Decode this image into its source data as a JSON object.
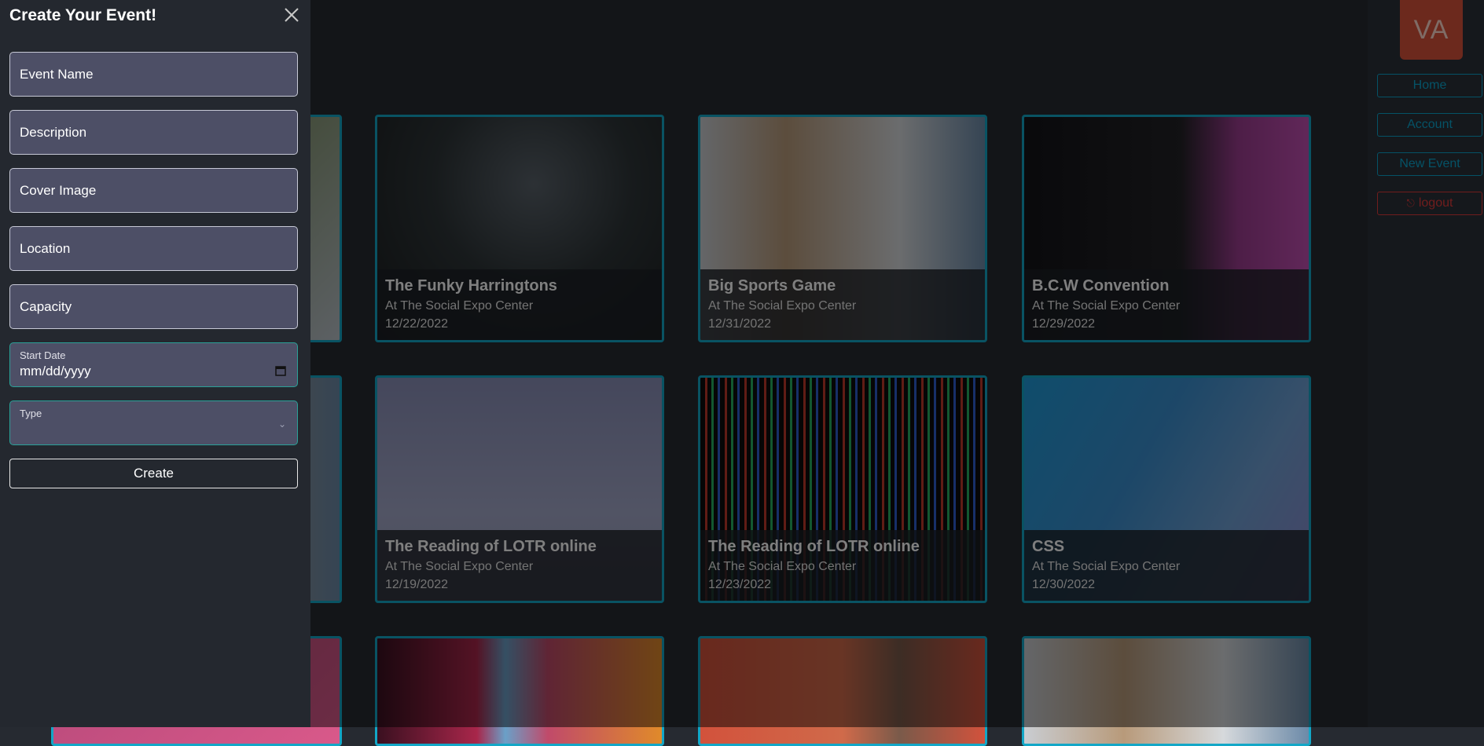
{
  "nav": {
    "avatar_initials": "VA",
    "home_label": "Home",
    "account_label": "Account",
    "new_event_label": "New Event",
    "logout_label": "logout",
    "accent_color": "#0aa4cc",
    "danger_color": "#e03a3a"
  },
  "events": [
    {
      "title": "The Funky Harringtons",
      "location": "At The Social Expo Center",
      "date": "12/22/2022"
    },
    {
      "title": "Big Sports Game",
      "location": "At The Social Expo Center",
      "date": "12/31/2022"
    },
    {
      "title": "B.C.W Convention",
      "location": "At The Social Expo Center",
      "date": "12/29/2022"
    },
    {
      "title": "The Reading of LOTR online",
      "location": "At The Social Expo Center",
      "date": "12/19/2022"
    },
    {
      "title": "The Reading of LOTR online",
      "location": "At The Social Expo Center",
      "date": "12/23/2022"
    },
    {
      "title": "CSS",
      "location": "At The Social Expo Center",
      "date": "12/30/2022"
    }
  ],
  "drawer": {
    "title": "Create Your Event!",
    "event_name_placeholder": "Event Name",
    "description_placeholder": "Description",
    "cover_image_placeholder": "Cover Image",
    "location_placeholder": "Location",
    "capacity_placeholder": "Capacity",
    "start_date_label": "Start Date",
    "start_date_value": "mm/dd/yyyy",
    "type_label": "Type",
    "create_label": "Create"
  }
}
